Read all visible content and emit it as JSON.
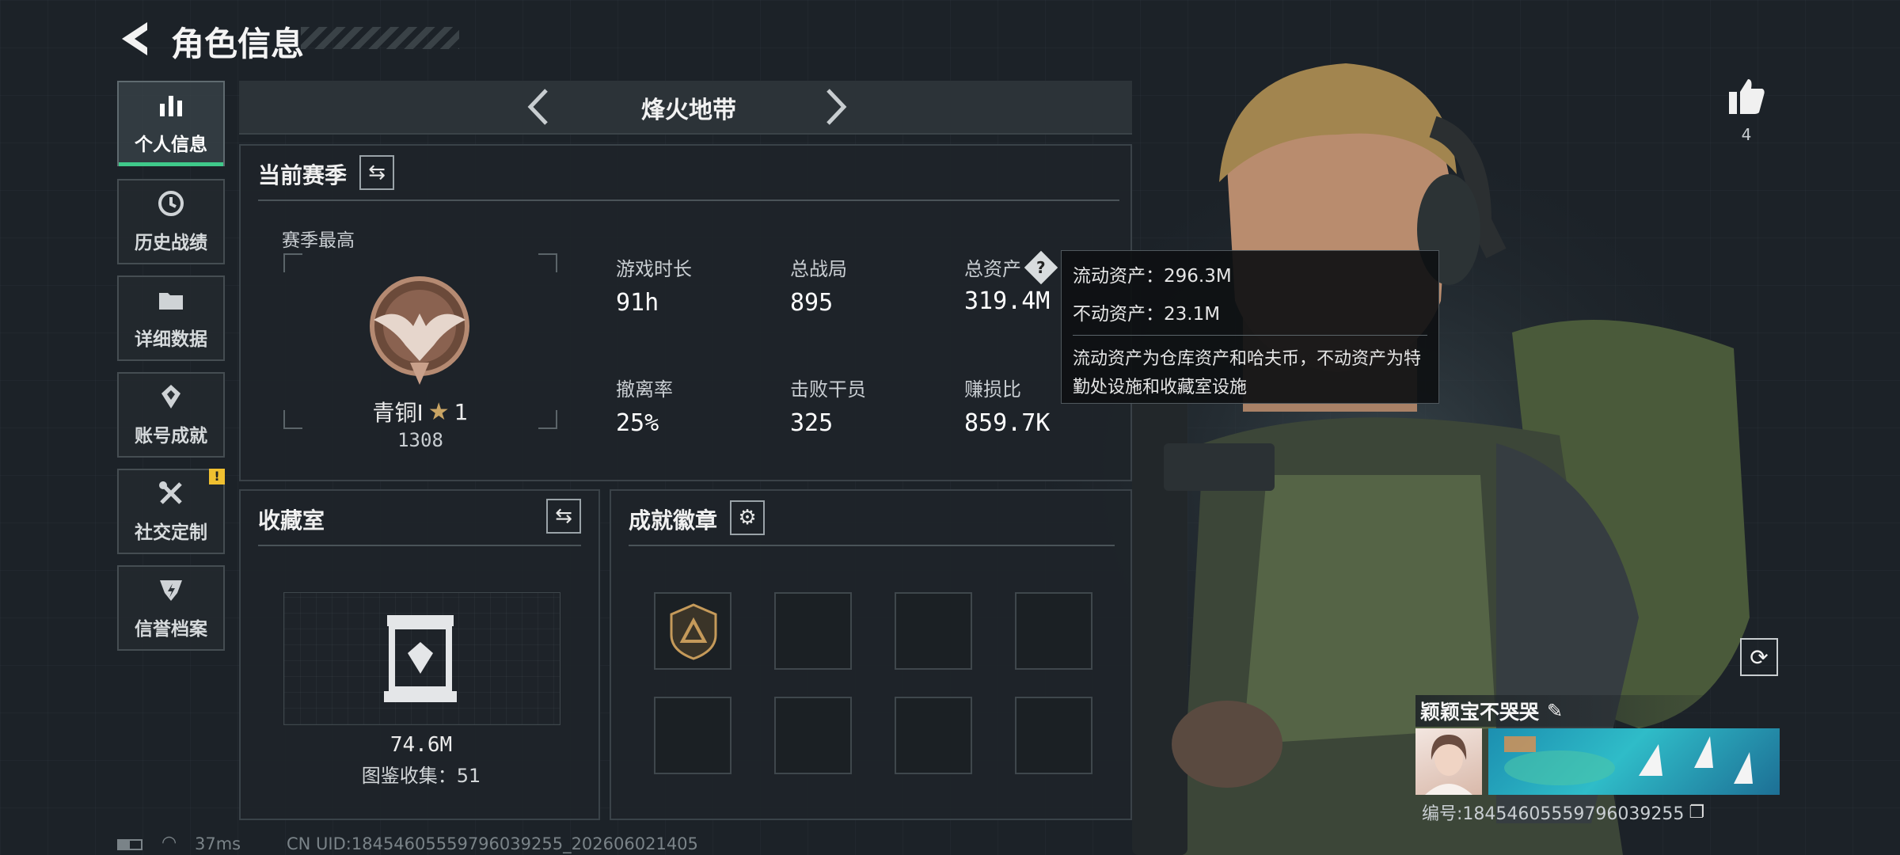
{
  "header": {
    "title": "角色信息"
  },
  "sidebar": {
    "items": [
      {
        "label": "个人信息",
        "icon": "bar-chart-icon",
        "active": true
      },
      {
        "label": "历史战绩",
        "icon": "history-icon"
      },
      {
        "label": "详细数据",
        "icon": "folder-icon"
      },
      {
        "label": "账号成就",
        "icon": "achievement-icon"
      },
      {
        "label": "社交定制",
        "icon": "tools-icon",
        "badge": "!"
      },
      {
        "label": "信誉档案",
        "icon": "shield-icon"
      }
    ]
  },
  "mode_selector": {
    "label": "烽火地带"
  },
  "season": {
    "title": "当前赛季",
    "best_label": "赛季最高",
    "rank_name": "青铜Ⅰ",
    "rank_stars": "1",
    "rank_points": "1308",
    "stats": [
      {
        "label": "游戏时长",
        "value": "91h"
      },
      {
        "label": "总战局",
        "value": "895"
      },
      {
        "label": "总资产",
        "value": "319.4M"
      },
      {
        "label": "撤离率",
        "value": "25%"
      },
      {
        "label": "击败干员",
        "value": "325"
      },
      {
        "label": "赚损比",
        "value": "859.7K"
      }
    ]
  },
  "tooltip": {
    "liquid": "流动资产：296.3M",
    "fixed": "不动资产：23.1M",
    "desc": "流动资产为仓库资产和哈夫币，不动资产为特勤处设施和收藏室设施"
  },
  "collection": {
    "title": "收藏室",
    "value": "74.6M",
    "sub": "图鉴收集：51"
  },
  "badges": {
    "title": "成就徽章"
  },
  "likes": {
    "count": "4"
  },
  "player": {
    "name": "颖颖宝不哭哭",
    "id": "编号:18454605559796039255"
  },
  "footer": {
    "ping": "37ms",
    "uid": "CN UID:18454605559796039255_202606021405"
  },
  "colors": {
    "accent": "#3fc98a",
    "badge": "#f0c030",
    "bg": "#1c2228"
  }
}
